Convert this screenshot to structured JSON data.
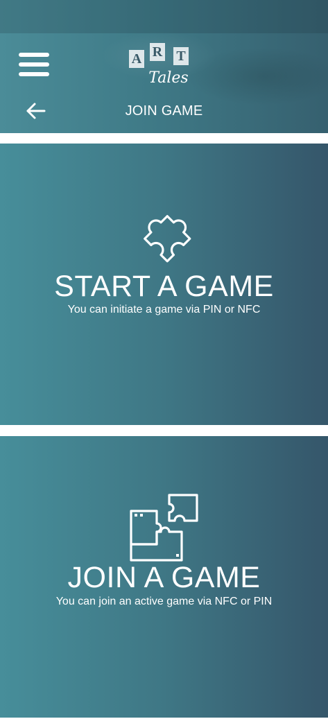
{
  "header": {
    "menu_icon": "hamburger-menu-icon",
    "logo": {
      "tiles": [
        "A",
        "R",
        "T"
      ],
      "subtitle": "Tales"
    },
    "back_icon": "arrow-left-icon",
    "title": "JOIN GAME"
  },
  "cards": {
    "start": {
      "icon": "puzzle-piece-icon",
      "title": "START A GAME",
      "subtitle": "You can initiate a game via PIN or NFC"
    },
    "join": {
      "icon": "puzzle-pieces-icon",
      "title": "JOIN A GAME",
      "subtitle": "You can join an active game via NFC or PIN"
    }
  },
  "colors": {
    "gradient_left": "#478e9a",
    "gradient_right": "#35566a",
    "text": "#ffffff",
    "background": "#ffffff"
  }
}
